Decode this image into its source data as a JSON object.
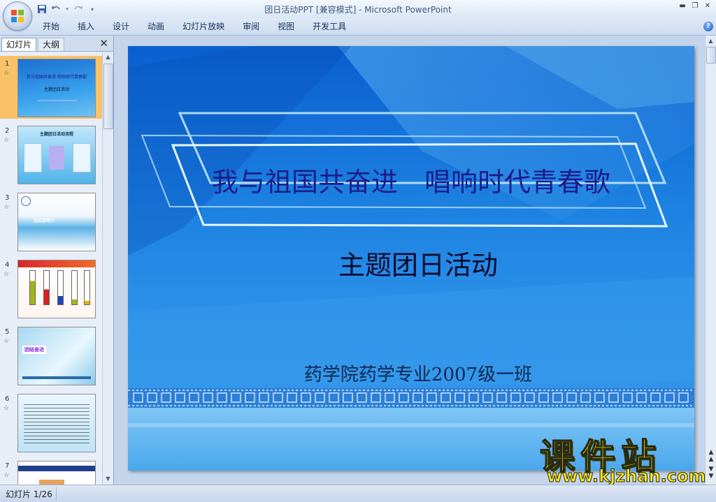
{
  "window": {
    "title": "团日活动PPT [兼容模式] - Microsoft PowerPoint",
    "controls": [
      "minimize",
      "restore",
      "close"
    ]
  },
  "quick_access": {
    "icons": [
      "save-icon",
      "undo-icon",
      "redo-icon",
      "customize-icon"
    ]
  },
  "ribbon_tabs": [
    "开始",
    "插入",
    "设计",
    "动画",
    "幻灯片放映",
    "审阅",
    "视图",
    "开发工具"
  ],
  "slides_pane": {
    "tabs": [
      "幻灯片",
      "大纲"
    ],
    "active_tab": "幻灯片",
    "thumbnails": [
      {
        "num": "1",
        "text": "我与祖国共奋进 唱响时代青春歌",
        "sub": "主题团日活动",
        "selected": true
      },
      {
        "num": "2",
        "text": "主题团日活动流程"
      },
      {
        "num": "3",
        "text": "团支部简介"
      },
      {
        "num": "4",
        "text": ""
      },
      {
        "num": "5",
        "text": "团结奋进"
      },
      {
        "num": "6",
        "text": ""
      },
      {
        "num": "7",
        "text": ""
      }
    ]
  },
  "slide": {
    "title": "我与祖国共奋进　唱响时代青春歌",
    "subtitle": "主题团日活动",
    "class_line": "药学院药学专业2007级一班"
  },
  "watermark": {
    "brand": "课件站",
    "url": "www.kjzhan.com"
  },
  "status": {
    "slide_indicator": "幻灯片 1/26"
  },
  "colors": {
    "slide_bg": "#1b7fe0",
    "title_color": "#1c1c8a",
    "selected_thumb": "#f9c168"
  }
}
